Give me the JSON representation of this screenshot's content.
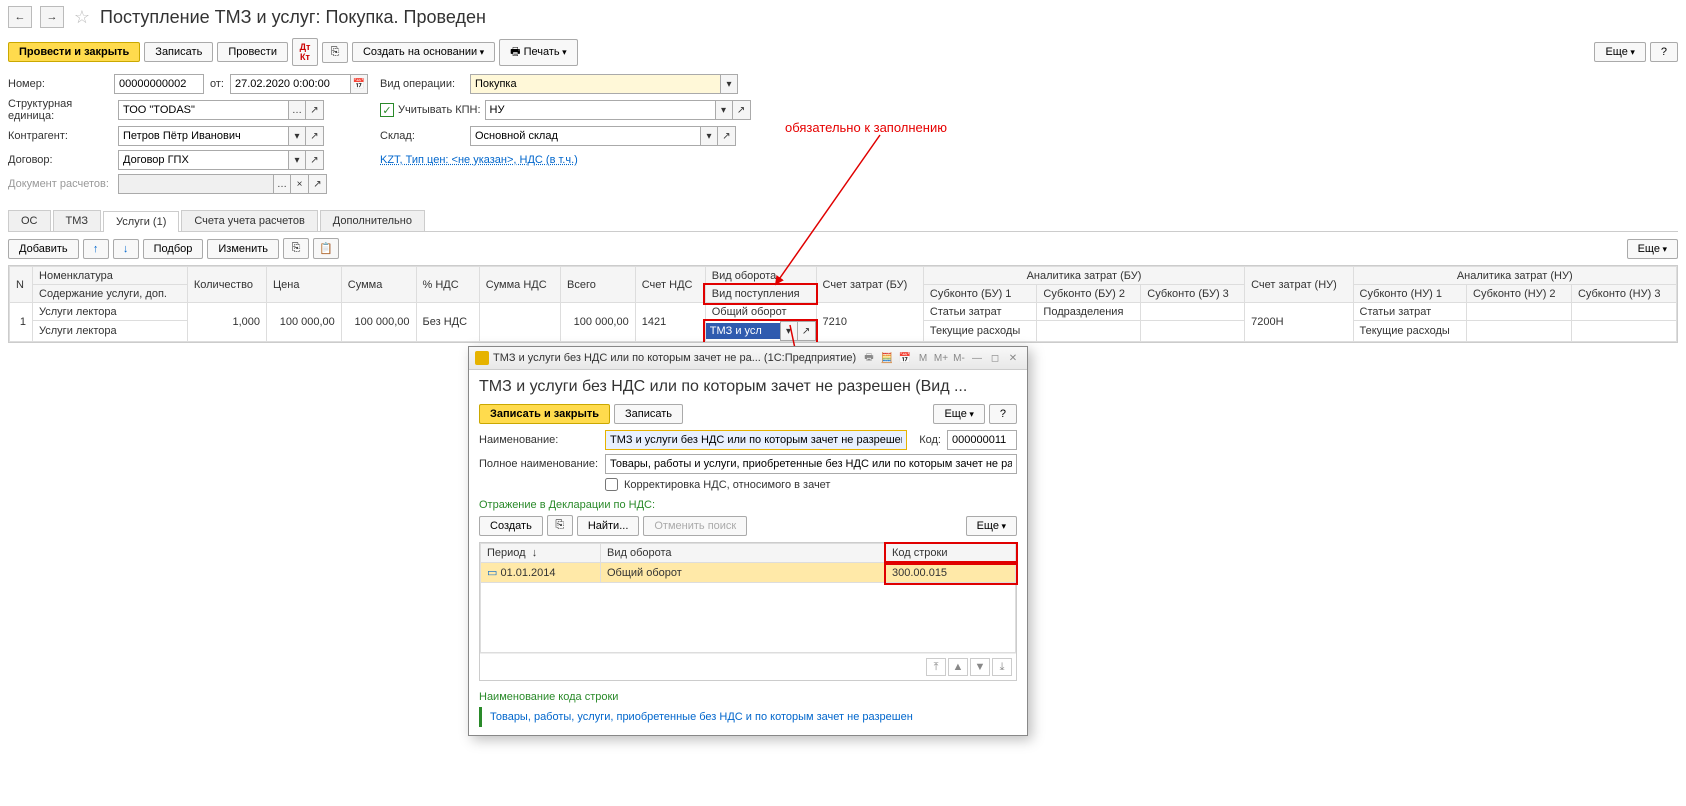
{
  "header": {
    "title": "Поступление ТМЗ и услуг: Покупка. Проведен"
  },
  "toolbar": {
    "post_close": "Провести и закрыть",
    "write": "Записать",
    "post": "Провести",
    "create_based": "Создать на основании",
    "print": "Печать",
    "more": "Еще",
    "help": "?"
  },
  "form": {
    "number_label": "Номер:",
    "number": "00000000002",
    "from_label": "от:",
    "date": "27.02.2020 0:00:00",
    "op_type_label": "Вид операции:",
    "op_type": "Покупка",
    "org_label": "Структурная единица:",
    "org": "ТОО \"TODAS\"",
    "consider_kpn_label": "Учитывать КПН:",
    "kpn": "НУ",
    "contragent_label": "Контрагент:",
    "contragent": "Петров Пётр Иванович",
    "warehouse_label": "Склад:",
    "warehouse": "Основной склад",
    "contract_label": "Договор:",
    "contract": "Договор ГПХ",
    "currency_note": "KZT, Тип цен: <не указан>, НДС (в т.ч.)",
    "settle_doc_label": "Документ расчетов:"
  },
  "tabs": [
    "ОС",
    "ТМЗ",
    "Услуги (1)",
    "Счета учета расчетов",
    "Дополнительно"
  ],
  "sub_toolbar": {
    "add": "Добавить",
    "pick": "Подбор",
    "change": "Изменить",
    "more": "Еще"
  },
  "grid": {
    "headers": {
      "n": "N",
      "nomenclature": "Номенклатура",
      "sub_desc": "Содержание услуги, доп.",
      "qty": "Количество",
      "price": "Цена",
      "sum": "Сумма",
      "vat_pct": "% НДС",
      "vat_sum": "Сумма НДС",
      "total": "Всего",
      "vat_acc": "Счет НДС",
      "turnover_type": "Вид оборота",
      "receipt_type": "Вид поступления",
      "cost_acc_bu": "Счет затрат (БУ)",
      "analytics_bu": "Аналитика затрат (БУ)",
      "sub_bu1": "Субконто (БУ) 1",
      "sub_bu2": "Субконто (БУ) 2",
      "sub_bu3": "Субконто (БУ) 3",
      "cost_acc_nu": "Счет затрат (НУ)",
      "analytics_nu": "Аналитика затрат (НУ)",
      "sub_nu1": "Субконто (НУ) 1",
      "sub_nu2": "Субконто (НУ) 2",
      "sub_nu3": "Субконто (НУ) 3"
    },
    "row": {
      "n": "1",
      "nom": "Услуги лектора",
      "nom2": "Услуги лектора",
      "qty": "1,000",
      "price": "100 000,00",
      "sum": "100 000,00",
      "vat_pct": "Без НДС",
      "total": "100 000,00",
      "vat_acc": "1421",
      "turnover": "Общий оборот",
      "receipt_input": "ТМЗ и усл",
      "cost_acc_bu": "7210",
      "sub_bu1": "Статьи затрат",
      "sub_bu1_2": "Текущие расходы",
      "sub_bu2": "Подразделения",
      "cost_acc_nu": "7200Н",
      "sub_nu1": "Статьи затрат",
      "sub_nu1_2": "Текущие расходы"
    }
  },
  "annotation": "обязательно к заполнению",
  "modal": {
    "titlebar": "ТМЗ и услуги без НДС или по которым зачет не ра... (1С:Предприятие)",
    "heading": "ТМЗ и услуги без НДС или по которым зачет не разрешен (Вид ...",
    "write_close": "Записать и закрыть",
    "write": "Записать",
    "more": "Еще",
    "help": "?",
    "name_label": "Наименование:",
    "name": "ТМЗ и услуги без НДС или по которым зачет не разрешен",
    "code_label": "Код:",
    "code": "000000011",
    "fullname_label": "Полное наименование:",
    "fullname": "Товары, работы и услуги, приобретенные без НДС или по которым зачет не разрешен",
    "checkbox_label": "Корректировка НДС, относимого в зачет",
    "section_head": "Отражение в Декларации по НДС:",
    "create": "Создать",
    "find": "Найти...",
    "cancel_find": "Отменить поиск",
    "grid": {
      "period_h": "Период",
      "turnover_h": "Вид оборота",
      "code_h": "Код строки",
      "period": "01.01.2014",
      "turnover": "Общий оборот",
      "code": "300.00.015"
    },
    "footer_head": "Наименование кода строки",
    "footer_note": "Товары, работы, услуги, приобретенные без НДС и по которым зачет не разрешен"
  }
}
